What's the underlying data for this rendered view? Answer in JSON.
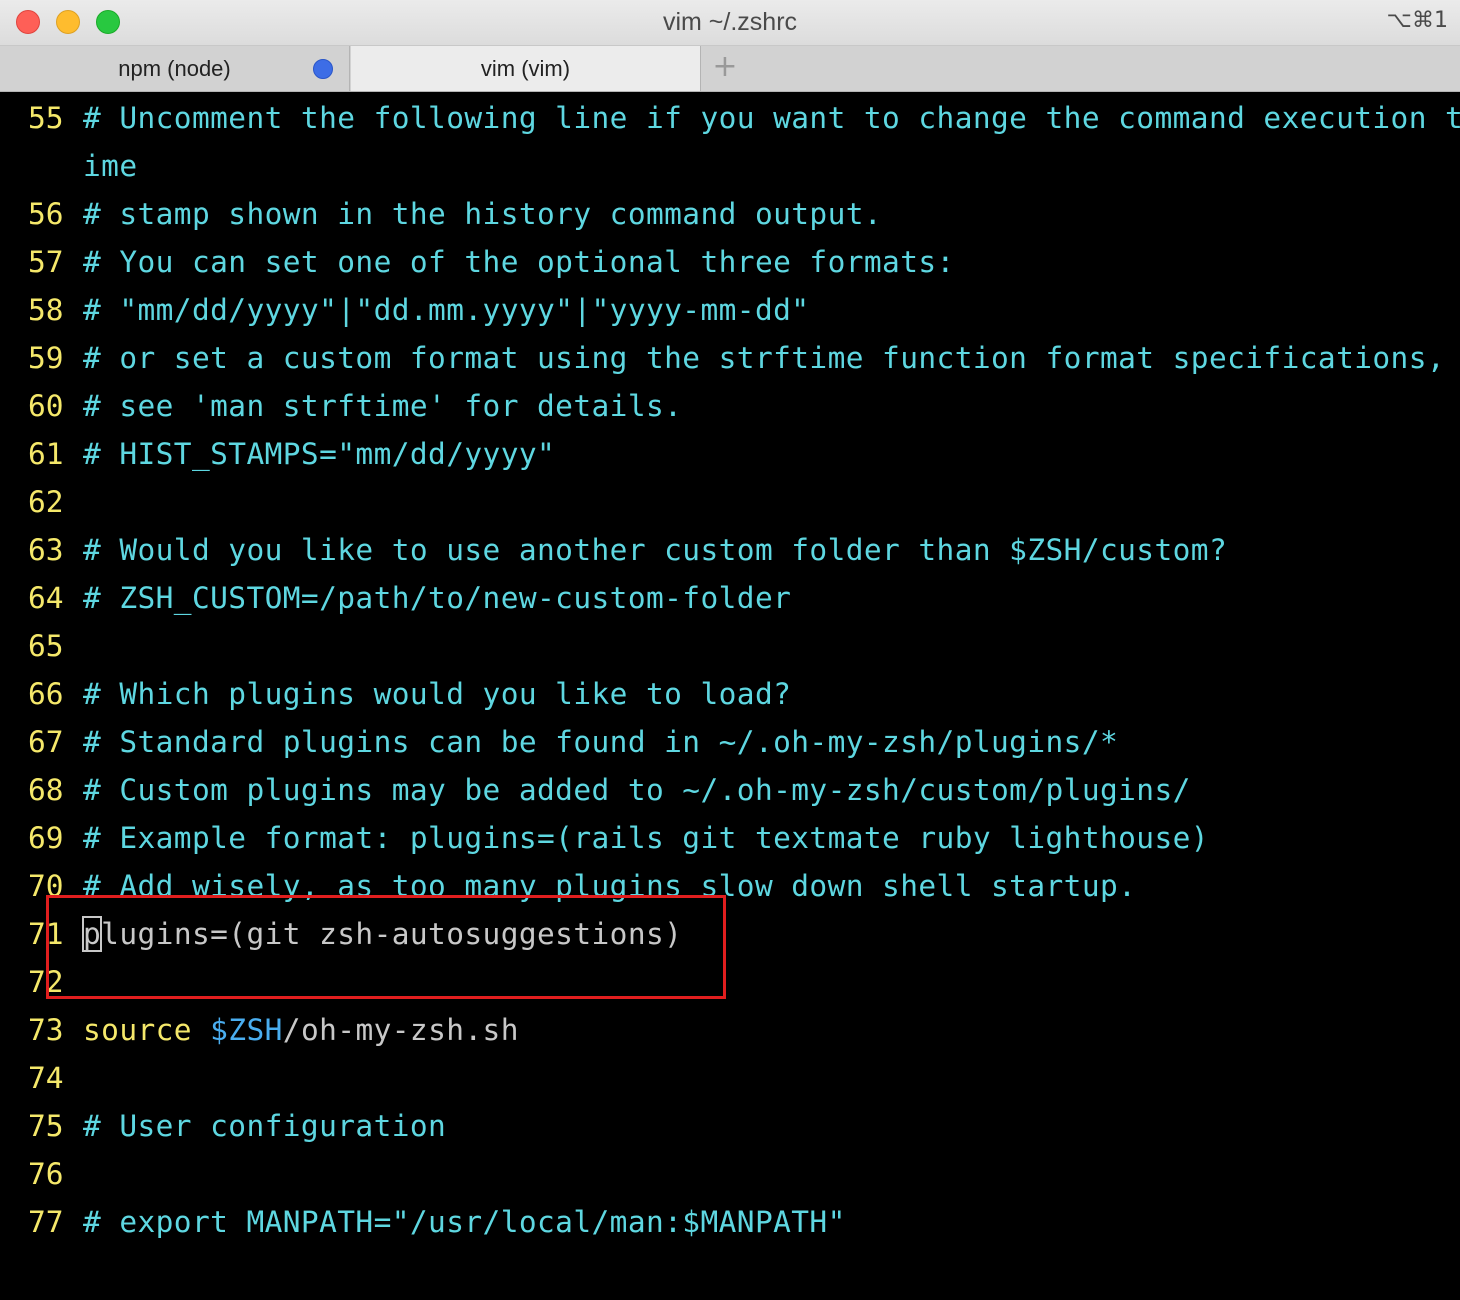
{
  "window": {
    "title": "vim ~/.zshrc",
    "shortcut": "⌥⌘1"
  },
  "tabs": [
    {
      "label": "npm (node)",
      "has_indicator": true
    },
    {
      "label": "vim (vim)",
      "active": true
    }
  ],
  "new_tab_icon": "plus-icon",
  "colors": {
    "line_number": "#f5e86a",
    "comment": "#5ed7e1",
    "plain_text": "#c8c8c8",
    "keyword": "#f5e86a",
    "variable": "#4aaef0",
    "highlight_box": "#e01e1e"
  },
  "lines": [
    {
      "num": "55",
      "text": "# Uncomment the following line if you want to change the command execution t"
    },
    {
      "num": "",
      "text": "ime"
    },
    {
      "num": "56",
      "text": "# stamp shown in the history command output."
    },
    {
      "num": "57",
      "text": "# You can set one of the optional three formats:"
    },
    {
      "num": "58",
      "text": "# \"mm/dd/yyyy\"|\"dd.mm.yyyy\"|\"yyyy-mm-dd\""
    },
    {
      "num": "59",
      "text": "# or set a custom format using the strftime function format specifications,"
    },
    {
      "num": "60",
      "text": "# see 'man strftime' for details."
    },
    {
      "num": "61",
      "text": "# HIST_STAMPS=\"mm/dd/yyyy\""
    },
    {
      "num": "62",
      "text": ""
    },
    {
      "num": "63",
      "text": "# Would you like to use another custom folder than $ZSH/custom?"
    },
    {
      "num": "64",
      "text": "# ZSH_CUSTOM=/path/to/new-custom-folder"
    },
    {
      "num": "65",
      "text": ""
    },
    {
      "num": "66",
      "text": "# Which plugins would you like to load?"
    },
    {
      "num": "67",
      "text": "# Standard plugins can be found in ~/.oh-my-zsh/plugins/*"
    },
    {
      "num": "68",
      "text": "# Custom plugins may be added to ~/.oh-my-zsh/custom/plugins/"
    },
    {
      "num": "69",
      "text": "# Example format: plugins=(rails git textmate ruby lighthouse)"
    },
    {
      "num": "70",
      "text": "# Add wisely, as too many plugins slow down shell startup."
    },
    {
      "num": "71",
      "cursor_char": "p",
      "text": "lugins=(git zsh-autosuggestions)"
    },
    {
      "num": "72",
      "text": ""
    },
    {
      "num": "73",
      "kw": "source",
      "var": "$ZSH",
      "rest": "/oh-my-zsh.sh"
    },
    {
      "num": "74",
      "text": ""
    },
    {
      "num": "75",
      "text": "# User configuration"
    },
    {
      "num": "76",
      "text": ""
    },
    {
      "num": "77",
      "text": "# export MANPATH=\"/usr/local/man:$MANPATH\""
    }
  ]
}
